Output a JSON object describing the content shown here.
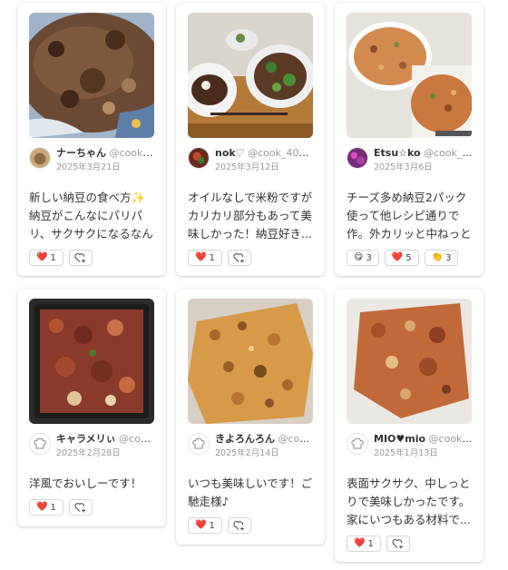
{
  "colors": {
    "accent": "#d63a4a",
    "muted": "#9a9a9a",
    "border": "#d6d6d6"
  },
  "cards": [
    {
      "author_name": "ナーちゃん",
      "author_handle": "@cook_4...",
      "date": "2025年3月21日",
      "comment": "新しい納豆の食べ方✨納豆がこんなにパリパリ、サクサクになるなんて‼︎...",
      "reactions": [
        {
          "icon": "heart-icon",
          "glyph": "❤️",
          "count": "1"
        }
      ]
    },
    {
      "author_name": "nok♡",
      "author_handle": "@cook_4015...",
      "date": "2025年3月12日",
      "comment": "オイルなしで米粉ですがカリカリ部分もあって美味しかった！納豆好き...",
      "reactions": [
        {
          "icon": "heart-icon",
          "glyph": "❤️",
          "count": "1"
        }
      ]
    },
    {
      "author_name": "Etsu☆ko",
      "author_handle": "@cook_41...",
      "date": "2025年3月6日",
      "comment": "チーズ多め納豆2パック使って他レシピ通りで作。外カリッと中ねっとり...",
      "reactions": [
        {
          "icon": "smile-icon",
          "glyph": "😋",
          "count": "3"
        },
        {
          "icon": "heart-icon",
          "glyph": "❤️",
          "count": "5"
        },
        {
          "icon": "clap-icon",
          "glyph": "👏",
          "count": "3"
        }
      ]
    },
    {
      "author_name": "キャラメリぃ",
      "author_handle": "@cook...",
      "date": "2025年2月28日",
      "comment": "洋風でおいしーです！",
      "reactions": [
        {
          "icon": "heart-icon",
          "glyph": "❤️",
          "count": "1"
        }
      ]
    },
    {
      "author_name": "きよろんろん",
      "author_handle": "@cook...",
      "date": "2025年2月14日",
      "comment": "いつも美味しいです！ご馳走様♪",
      "reactions": [
        {
          "icon": "heart-icon",
          "glyph": "❤️",
          "count": "1"
        }
      ]
    },
    {
      "author_name": "MIO♥mio",
      "author_handle": "@cook_4...",
      "date": "2025年1月13日",
      "comment": "表面サクサク、中しっとりで美味しかったです。家にいつもある材料で...",
      "reactions": [
        {
          "icon": "heart-icon",
          "glyph": "❤️",
          "count": "1"
        }
      ]
    }
  ]
}
